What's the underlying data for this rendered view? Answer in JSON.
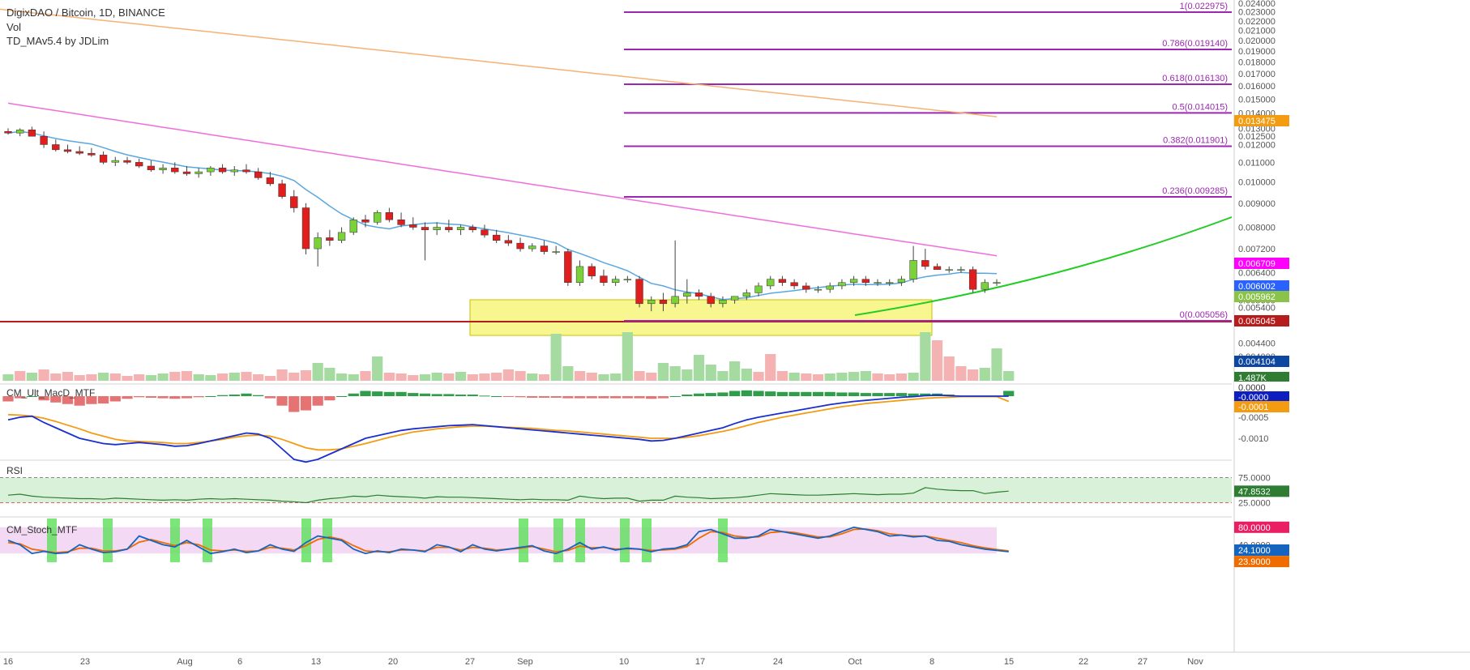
{
  "header": {
    "title": "DigixDAO / Bitcoin, 1D, BINANCE",
    "vol_label": "Vol",
    "indicator_label": "TD_MAv5.4 by JDLim"
  },
  "panes": {
    "macd_title": "CM_Ult_MacD_MTF",
    "rsi_title": "RSI",
    "stoch_title": "CM_Stoch_MTF"
  },
  "chart_data": {
    "type": "candlestick",
    "symbol": "DigixDAO / Bitcoin",
    "interval": "1D",
    "exchange": "BINANCE",
    "y_axis_ticks": [
      "0.024000",
      "0.023000",
      "0.022000",
      "0.021000",
      "0.020000",
      "0.019000",
      "0.018000",
      "0.017000",
      "0.016000",
      "0.015000",
      "0.014000",
      "0.013000",
      "0.012500",
      "0.012000",
      "0.011000",
      "0.010000",
      "0.009000",
      "0.008000",
      "0.007200",
      "0.006400",
      "0.006000",
      "0.005600",
      "0.005400",
      "0.005000",
      "0.004400",
      "0.004000"
    ],
    "x_axis_ticks": [
      "16",
      "23",
      "Aug",
      "6",
      "13",
      "20",
      "27",
      "Sep",
      "10",
      "17",
      "24",
      "Oct",
      "8",
      "15",
      "22",
      "27",
      "Nov"
    ],
    "fib_levels": [
      {
        "label": "1(0.022975)",
        "value": 0.022975
      },
      {
        "label": "0.786(0.019140)",
        "value": 0.01914
      },
      {
        "label": "0.618(0.016130)",
        "value": 0.01613
      },
      {
        "label": "0.5(0.014015)",
        "value": 0.014015
      },
      {
        "label": "0.382(0.011901)",
        "value": 0.011901
      },
      {
        "label": "0.236(0.009285)",
        "value": 0.009285
      },
      {
        "label": "0(0.005056)",
        "value": 0.005056
      }
    ],
    "price_tags": [
      {
        "label": "0.013475",
        "color": "#f39c12"
      },
      {
        "label": "0.006709",
        "color": "#ff00ff"
      },
      {
        "label": "0.006002",
        "color": "#2962ff"
      },
      {
        "label": "0.005962",
        "color": "#8bc34a"
      },
      {
        "label": "0.005045",
        "color": "#b71c1c"
      },
      {
        "label": "0.004104",
        "color": "#0d47a1"
      },
      {
        "label": "1.487K",
        "color": "#2e7d32"
      }
    ],
    "macd_axis_ticks": [
      "0.0000",
      "-0.0000",
      "-0.0001",
      "-0.0005",
      "-0.0010"
    ],
    "macd_tags": [
      {
        "label": "0.0000",
        "color": "#ffffff"
      },
      {
        "label": "-0.0000",
        "color": "#0d1fbf"
      },
      {
        "label": "-0.0001",
        "color": "#f39c12"
      }
    ],
    "rsi_axis_ticks": [
      "75.0000",
      "25.0000"
    ],
    "rsi_tag": {
      "label": "47.8532",
      "color": "#2e7d32"
    },
    "stoch_axis_ticks": [
      "80.0000",
      "40.0000"
    ],
    "stoch_tags": [
      {
        "label": "80.0000",
        "color": "#e91e63"
      },
      {
        "label": "24.1000",
        "color": "#1565c0"
      },
      {
        "label": "23.9000",
        "color": "#ef6c00"
      }
    ],
    "candles": [
      [
        0.0128,
        0.013,
        0.0126,
        0.0127
      ],
      [
        0.0127,
        0.013,
        0.0125,
        0.0129
      ],
      [
        0.0129,
        0.0131,
        0.0127,
        0.0125
      ],
      [
        0.0125,
        0.0128,
        0.0118,
        0.012
      ],
      [
        0.012,
        0.0123,
        0.0116,
        0.0117
      ],
      [
        0.0117,
        0.012,
        0.0115,
        0.0116
      ],
      [
        0.0116,
        0.0119,
        0.0114,
        0.0115
      ],
      [
        0.0115,
        0.0118,
        0.0113,
        0.0114
      ],
      [
        0.0114,
        0.0116,
        0.0109,
        0.011
      ],
      [
        0.011,
        0.0113,
        0.0108,
        0.0111
      ],
      [
        0.0111,
        0.0113,
        0.0109,
        0.011
      ],
      [
        0.011,
        0.0112,
        0.0107,
        0.0108
      ],
      [
        0.0108,
        0.0111,
        0.0105,
        0.0106
      ],
      [
        0.0106,
        0.0109,
        0.0104,
        0.0107
      ],
      [
        0.0107,
        0.011,
        0.0104,
        0.0105
      ],
      [
        0.0105,
        0.0108,
        0.0103,
        0.0104
      ],
      [
        0.0104,
        0.0107,
        0.0102,
        0.0105
      ],
      [
        0.0105,
        0.0108,
        0.0103,
        0.0107
      ],
      [
        0.0107,
        0.0109,
        0.0104,
        0.0105
      ],
      [
        0.0105,
        0.0108,
        0.0103,
        0.0106
      ],
      [
        0.0106,
        0.0109,
        0.0104,
        0.0105
      ],
      [
        0.0105,
        0.0107,
        0.0101,
        0.0102
      ],
      [
        0.0102,
        0.0105,
        0.0098,
        0.0099
      ],
      [
        0.0099,
        0.0101,
        0.0092,
        0.0093
      ],
      [
        0.0093,
        0.0096,
        0.0086,
        0.0088
      ],
      [
        0.0088,
        0.009,
        0.007,
        0.0072
      ],
      [
        0.0072,
        0.0078,
        0.0066,
        0.0076
      ],
      [
        0.0076,
        0.0079,
        0.0073,
        0.0075
      ],
      [
        0.0075,
        0.008,
        0.0074,
        0.0078
      ],
      [
        0.0078,
        0.0084,
        0.0077,
        0.0083
      ],
      [
        0.0083,
        0.0085,
        0.008,
        0.0082
      ],
      [
        0.0082,
        0.0087,
        0.0081,
        0.0086
      ],
      [
        0.0086,
        0.0088,
        0.0082,
        0.0083
      ],
      [
        0.0083,
        0.0086,
        0.008,
        0.0081
      ],
      [
        0.0081,
        0.0084,
        0.0079,
        0.008
      ],
      [
        0.008,
        0.0082,
        0.0068,
        0.0079
      ],
      [
        0.0079,
        0.0082,
        0.0077,
        0.008
      ],
      [
        0.008,
        0.0083,
        0.0078,
        0.0079
      ],
      [
        0.0079,
        0.0081,
        0.0077,
        0.008
      ],
      [
        0.008,
        0.0081,
        0.0078,
        0.0079
      ],
      [
        0.0079,
        0.0081,
        0.0076,
        0.0077
      ],
      [
        0.0077,
        0.0079,
        0.0074,
        0.0075
      ],
      [
        0.0075,
        0.0077,
        0.0073,
        0.0074
      ],
      [
        0.0074,
        0.0076,
        0.0071,
        0.0072
      ],
      [
        0.0072,
        0.0074,
        0.0071,
        0.0073
      ],
      [
        0.0073,
        0.0075,
        0.007,
        0.0071
      ],
      [
        0.0071,
        0.0073,
        0.007,
        0.0071
      ],
      [
        0.0071,
        0.0072,
        0.006,
        0.0061
      ],
      [
        0.0061,
        0.0068,
        0.006,
        0.0066
      ],
      [
        0.0066,
        0.0067,
        0.0062,
        0.0063
      ],
      [
        0.0063,
        0.0065,
        0.006,
        0.0061
      ],
      [
        0.0061,
        0.0063,
        0.006,
        0.0062
      ],
      [
        0.0062,
        0.0063,
        0.0061,
        0.0062
      ],
      [
        0.0062,
        0.0063,
        0.0054,
        0.0055
      ],
      [
        0.0055,
        0.0057,
        0.0053,
        0.0056
      ],
      [
        0.0056,
        0.0058,
        0.0053,
        0.0055
      ],
      [
        0.0055,
        0.0075,
        0.0054,
        0.0057
      ],
      [
        0.0057,
        0.0062,
        0.0055,
        0.0058
      ],
      [
        0.0058,
        0.0059,
        0.0056,
        0.0057
      ],
      [
        0.0057,
        0.0058,
        0.0054,
        0.0055
      ],
      [
        0.0055,
        0.0057,
        0.0054,
        0.0056
      ],
      [
        0.0056,
        0.0057,
        0.0055,
        0.0057
      ],
      [
        0.0057,
        0.0059,
        0.0056,
        0.0058
      ],
      [
        0.0058,
        0.0061,
        0.0057,
        0.006
      ],
      [
        0.006,
        0.0063,
        0.0059,
        0.0062
      ],
      [
        0.0062,
        0.0063,
        0.006,
        0.0061
      ],
      [
        0.0061,
        0.0062,
        0.0059,
        0.006
      ],
      [
        0.006,
        0.0061,
        0.0058,
        0.0059
      ],
      [
        0.0059,
        0.006,
        0.0058,
        0.0059
      ],
      [
        0.0059,
        0.0061,
        0.0058,
        0.006
      ],
      [
        0.006,
        0.0062,
        0.0059,
        0.0061
      ],
      [
        0.0061,
        0.0063,
        0.006,
        0.0062
      ],
      [
        0.0062,
        0.0063,
        0.006,
        0.0061
      ],
      [
        0.0061,
        0.0062,
        0.006,
        0.0061
      ],
      [
        0.0061,
        0.0062,
        0.006,
        0.0061
      ],
      [
        0.0061,
        0.0063,
        0.006,
        0.0062
      ],
      [
        0.0062,
        0.0073,
        0.0061,
        0.0068
      ],
      [
        0.0068,
        0.0072,
        0.0065,
        0.0066
      ],
      [
        0.0066,
        0.0067,
        0.0065,
        0.0065
      ],
      [
        0.0065,
        0.0066,
        0.0064,
        0.0065
      ],
      [
        0.0065,
        0.0066,
        0.0064,
        0.0065
      ],
      [
        0.0065,
        0.0066,
        0.0058,
        0.0059
      ],
      [
        0.0059,
        0.0062,
        0.0058,
        0.0061
      ],
      [
        0.0061,
        0.0062,
        0.006,
        0.0061
      ]
    ],
    "volume": [
      8,
      12,
      10,
      14,
      9,
      11,
      7,
      8,
      10,
      9,
      6,
      8,
      7,
      9,
      11,
      12,
      8,
      7,
      9,
      10,
      11,
      8,
      6,
      14,
      10,
      13,
      22,
      16,
      9,
      8,
      12,
      30,
      10,
      9,
      7,
      8,
      10,
      9,
      11,
      8,
      9,
      10,
      14,
      12,
      9,
      8,
      58,
      18,
      12,
      10,
      8,
      9,
      60,
      12,
      10,
      22,
      18,
      14,
      32,
      20,
      12,
      24,
      15,
      11,
      33,
      12,
      10,
      9,
      8,
      9,
      10,
      11,
      12,
      9,
      8,
      9,
      10,
      60,
      50,
      30,
      18,
      14,
      16,
      40,
      12
    ],
    "volume_up": [
      1,
      0,
      1,
      0,
      0,
      0,
      0,
      0,
      1,
      0,
      0,
      0,
      1,
      1,
      0,
      0,
      1,
      1,
      0,
      1,
      0,
      0,
      0,
      0,
      0,
      0,
      1,
      1,
      1,
      1,
      0,
      1,
      0,
      0,
      0,
      1,
      1,
      0,
      1,
      0,
      0,
      0,
      0,
      0,
      1,
      0,
      1,
      1,
      0,
      0,
      1,
      1,
      1,
      0,
      0,
      1,
      1,
      1,
      1,
      1,
      1,
      1,
      1,
      0,
      0,
      0,
      1,
      0,
      0,
      1,
      1,
      1,
      1,
      0,
      0,
      0,
      1,
      1,
      0,
      0,
      0,
      0,
      1,
      1,
      1
    ],
    "rsi": [
      40,
      42,
      38,
      36,
      35,
      34,
      33,
      33,
      32,
      34,
      33,
      32,
      31,
      30,
      31,
      30,
      32,
      33,
      32,
      33,
      32,
      31,
      30,
      28,
      27,
      25,
      30,
      33,
      35,
      38,
      37,
      40,
      38,
      37,
      36,
      34,
      37,
      36,
      36,
      35,
      34,
      33,
      32,
      31,
      32,
      31,
      31,
      30,
      38,
      35,
      33,
      34,
      34,
      28,
      30,
      30,
      38,
      36,
      35,
      33,
      34,
      35,
      37,
      40,
      43,
      42,
      41,
      40,
      40,
      41,
      42,
      43,
      42,
      41,
      42,
      42,
      44,
      55,
      52,
      50,
      49,
      49,
      43,
      46,
      48
    ],
    "stoch_k": [
      50,
      40,
      20,
      25,
      20,
      22,
      40,
      30,
      22,
      24,
      30,
      60,
      50,
      40,
      35,
      50,
      35,
      20,
      24,
      30,
      22,
      26,
      40,
      30,
      25,
      45,
      60,
      55,
      50,
      30,
      20,
      26,
      22,
      30,
      28,
      24,
      40,
      35,
      24,
      40,
      30,
      26,
      30,
      34,
      38,
      26,
      20,
      30,
      45,
      30,
      35,
      28,
      32,
      30,
      24,
      30,
      32,
      40,
      70,
      75,
      65,
      55,
      55,
      60,
      75,
      70,
      65,
      60,
      55,
      60,
      70,
      80,
      75,
      70,
      60,
      62,
      58,
      60,
      50,
      48,
      40,
      35,
      30,
      27,
      24
    ],
    "stoch_d": [
      45,
      42,
      30,
      26,
      22,
      24,
      32,
      32,
      26,
      26,
      30,
      46,
      52,
      45,
      38,
      45,
      40,
      28,
      26,
      28,
      25,
      26,
      34,
      32,
      28,
      38,
      52,
      58,
      52,
      38,
      26,
      24,
      24,
      28,
      28,
      26,
      34,
      34,
      28,
      34,
      32,
      28,
      30,
      32,
      36,
      30,
      24,
      27,
      37,
      33,
      34,
      30,
      31,
      30,
      27,
      28,
      30,
      36,
      55,
      70,
      68,
      60,
      57,
      58,
      68,
      70,
      68,
      63,
      58,
      58,
      65,
      75,
      76,
      72,
      65,
      62,
      60,
      60,
      55,
      50,
      45,
      38,
      33,
      29,
      26
    ],
    "macd_line": [
      -0.00045,
      -0.0004,
      -0.00038,
      -0.0005,
      -0.0006,
      -0.0007,
      -0.0008,
      -0.00085,
      -0.0009,
      -0.00092,
      -0.0009,
      -0.00088,
      -0.0009,
      -0.00092,
      -0.00095,
      -0.00094,
      -0.0009,
      -0.00085,
      -0.0008,
      -0.00075,
      -0.0007,
      -0.00072,
      -0.0008,
      -0.001,
      -0.0012,
      -0.00125,
      -0.0012,
      -0.0011,
      -0.001,
      -0.0009,
      -0.0008,
      -0.00075,
      -0.0007,
      -0.00065,
      -0.00062,
      -0.0006,
      -0.00058,
      -0.00056,
      -0.00055,
      -0.00054,
      -0.00056,
      -0.00058,
      -0.0006,
      -0.00062,
      -0.00064,
      -0.00066,
      -0.00068,
      -0.0007,
      -0.00072,
      -0.00074,
      -0.00076,
      -0.00078,
      -0.0008,
      -0.00082,
      -0.00085,
      -0.00084,
      -0.0008,
      -0.00075,
      -0.0007,
      -0.00065,
      -0.0006,
      -0.00052,
      -0.00045,
      -0.0004,
      -0.00036,
      -0.00032,
      -0.00028,
      -0.00024,
      -0.0002,
      -0.00016,
      -0.00013,
      -0.0001,
      -8e-05,
      -6e-05,
      -4e-05,
      -2e-05,
      -1e-05,
      1e-05,
      2e-05,
      1e-05,
      0.0,
      0.0,
      0.0,
      0.0,
      0.0
    ],
    "macd_signal": [
      -0.00035,
      -0.00036,
      -0.00038,
      -0.00042,
      -0.00048,
      -0.00055,
      -0.00062,
      -0.0007,
      -0.00076,
      -0.00082,
      -0.00085,
      -0.00086,
      -0.00087,
      -0.00088,
      -0.0009,
      -0.0009,
      -0.00088,
      -0.00085,
      -0.00082,
      -0.00078,
      -0.00075,
      -0.00074,
      -0.00076,
      -0.00082,
      -0.0009,
      -0.00098,
      -0.00102,
      -0.00102,
      -0.001,
      -0.00095,
      -0.0009,
      -0.00084,
      -0.00078,
      -0.00073,
      -0.00068,
      -0.00065,
      -0.00062,
      -0.0006,
      -0.00058,
      -0.00057,
      -0.00057,
      -0.00058,
      -0.00059,
      -0.0006,
      -0.00061,
      -0.00063,
      -0.00065,
      -0.00066,
      -0.00068,
      -0.0007,
      -0.00072,
      -0.00074,
      -0.00076,
      -0.00078,
      -0.0008,
      -0.0008,
      -0.0008,
      -0.00078,
      -0.00075,
      -0.00071,
      -0.00067,
      -0.00062,
      -0.00056,
      -0.0005,
      -0.00045,
      -0.0004,
      -0.00036,
      -0.00032,
      -0.00028,
      -0.00024,
      -0.0002,
      -0.00017,
      -0.00014,
      -0.00012,
      -0.0001,
      -8e-05,
      -6e-05,
      -4e-05,
      -3e-05,
      -2e-05,
      -1e-05,
      -1e-05,
      -1e-05,
      -1e-05,
      -0.0001
    ]
  }
}
